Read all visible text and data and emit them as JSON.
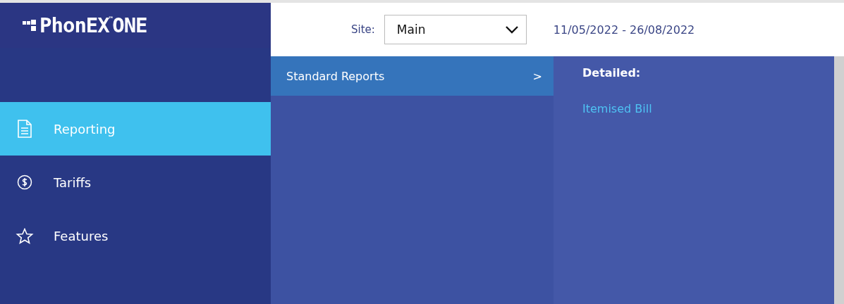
{
  "logo": {
    "text": "PhonEX$^{™}$ONE"
  },
  "sidebar": {
    "items": [
      {
        "label": "Reporting",
        "kind": "document",
        "selected": true
      },
      {
        "label": "Tariffs",
        "kind": "dollar",
        "selected": false
      },
      {
        "label": "Features",
        "kind": "star",
        "selected": false
      }
    ]
  },
  "header": {
    "site_label": "Site:",
    "site_value": "Main",
    "date_range": "11/05/2022 - 26/08/2022"
  },
  "menu": {
    "items": [
      {
        "label": "Standard Reports",
        "arrow": ">",
        "selected": true
      }
    ]
  },
  "submenu": {
    "heading": "Detailed:",
    "links": [
      "Itemised Bill"
    ]
  }
}
